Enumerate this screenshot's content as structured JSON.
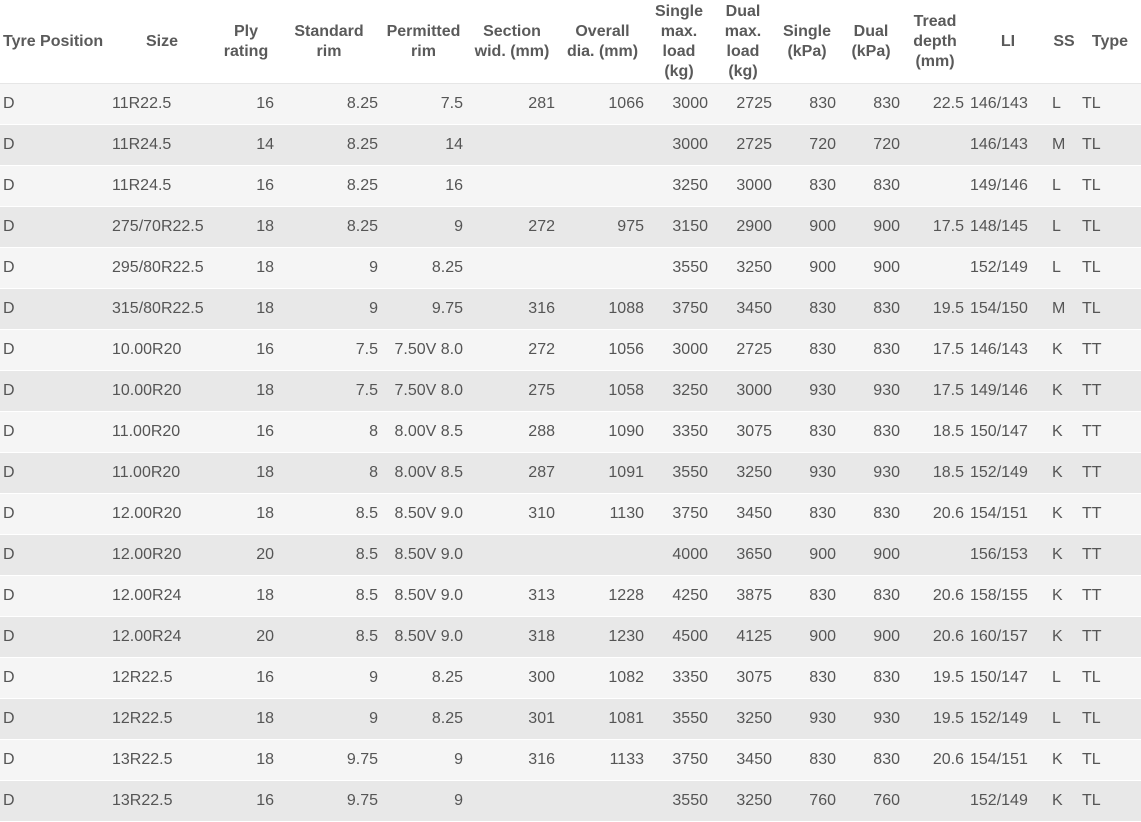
{
  "table": {
    "headers": {
      "position": "Tyre Position",
      "size": "Size",
      "ply": "Ply rating",
      "std_rim": "Standard rim",
      "perm_rim": "Permitted rim",
      "section": "Section wid. (mm)",
      "overall": "Overall dia. (mm)",
      "single_load": "Single max. load (kg)",
      "dual_load": "Dual max. load (kg)",
      "single_kpa": "Single (kPa)",
      "dual_kpa": "Dual (kPa)",
      "tread": "Tread depth (mm)",
      "li": "LI",
      "ss": "SS",
      "type": "Type"
    },
    "rows": [
      [
        "D",
        "11R22.5",
        "16",
        "8.25",
        "7.5",
        "281",
        "1066",
        "3000",
        "2725",
        "830",
        "830",
        "22.5",
        "146/143",
        "L",
        "TL"
      ],
      [
        "D",
        "11R24.5",
        "14",
        "8.25",
        "14",
        "",
        "",
        "3000",
        "2725",
        "720",
        "720",
        "",
        "146/143",
        "M",
        "TL"
      ],
      [
        "D",
        "11R24.5",
        "16",
        "8.25",
        "16",
        "",
        "",
        "3250",
        "3000",
        "830",
        "830",
        "",
        "149/146",
        "L",
        "TL"
      ],
      [
        "D",
        "275/70R22.5",
        "18",
        "8.25",
        "9",
        "272",
        "975",
        "3150",
        "2900",
        "900",
        "900",
        "17.5",
        "148/145",
        "L",
        "TL"
      ],
      [
        "D",
        "295/80R22.5",
        "18",
        "9",
        "8.25",
        "",
        "",
        "3550",
        "3250",
        "900",
        "900",
        "",
        "152/149",
        "L",
        "TL"
      ],
      [
        "D",
        "315/80R22.5",
        "18",
        "9",
        "9.75",
        "316",
        "1088",
        "3750",
        "3450",
        "830",
        "830",
        "19.5",
        "154/150",
        "M",
        "TL"
      ],
      [
        "D",
        "10.00R20",
        "16",
        "7.5",
        "7.50V 8.0",
        "272",
        "1056",
        "3000",
        "2725",
        "830",
        "830",
        "17.5",
        "146/143",
        "K",
        "TT"
      ],
      [
        "D",
        "10.00R20",
        "18",
        "7.5",
        "7.50V 8.0",
        "275",
        "1058",
        "3250",
        "3000",
        "930",
        "930",
        "17.5",
        "149/146",
        "K",
        "TT"
      ],
      [
        "D",
        "11.00R20",
        "16",
        "8",
        "8.00V 8.5",
        "288",
        "1090",
        "3350",
        "3075",
        "830",
        "830",
        "18.5",
        "150/147",
        "K",
        "TT"
      ],
      [
        "D",
        "11.00R20",
        "18",
        "8",
        "8.00V 8.5",
        "287",
        "1091",
        "3550",
        "3250",
        "930",
        "930",
        "18.5",
        "152/149",
        "K",
        "TT"
      ],
      [
        "D",
        "12.00R20",
        "18",
        "8.5",
        "8.50V 9.0",
        "310",
        "1130",
        "3750",
        "3450",
        "830",
        "830",
        "20.6",
        "154/151",
        "K",
        "TT"
      ],
      [
        "D",
        "12.00R20",
        "20",
        "8.5",
        "8.50V 9.0",
        "",
        "",
        "4000",
        "3650",
        "900",
        "900",
        "",
        "156/153",
        "K",
        "TT"
      ],
      [
        "D",
        "12.00R24",
        "18",
        "8.5",
        "8.50V 9.0",
        "313",
        "1228",
        "4250",
        "3875",
        "830",
        "830",
        "20.6",
        "158/155",
        "K",
        "TT"
      ],
      [
        "D",
        "12.00R24",
        "20",
        "8.5",
        "8.50V 9.0",
        "318",
        "1230",
        "4500",
        "4125",
        "900",
        "900",
        "20.6",
        "160/157",
        "K",
        "TT"
      ],
      [
        "D",
        "12R22.5",
        "16",
        "9",
        "8.25",
        "300",
        "1082",
        "3350",
        "3075",
        "830",
        "830",
        "19.5",
        "150/147",
        "L",
        "TL"
      ],
      [
        "D",
        "12R22.5",
        "18",
        "9",
        "8.25",
        "301",
        "1081",
        "3550",
        "3250",
        "930",
        "930",
        "19.5",
        "152/149",
        "L",
        "TL"
      ],
      [
        "D",
        "13R22.5",
        "18",
        "9.75",
        "9",
        "316",
        "1133",
        "3750",
        "3450",
        "830",
        "830",
        "20.6",
        "154/151",
        "K",
        "TL"
      ],
      [
        "D",
        "13R22.5",
        "16",
        "9.75",
        "9",
        "",
        "",
        "3550",
        "3250",
        "760",
        "760",
        "",
        "152/149",
        "K",
        "TL"
      ]
    ]
  }
}
